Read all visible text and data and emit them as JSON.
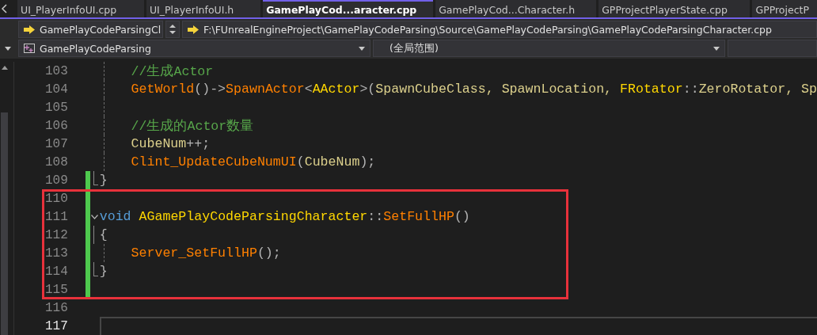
{
  "tabs": [
    {
      "label": "UI_PlayerInfoUI.cpp",
      "selected": false
    },
    {
      "label": "UI_PlayerInfoUI.h",
      "selected": false
    },
    {
      "label": "GamePlayCod...aracter.cpp",
      "selected": true
    },
    {
      "label": "GamePlayCod...Character.h",
      "selected": false
    },
    {
      "label": "GPProjectPlayerState.cpp",
      "selected": false
    },
    {
      "label": "GPProjectP",
      "selected": false
    }
  ],
  "navigation": {
    "member_dropdown": "GamePlayCodeParsingCl",
    "file_path": "F:\\FUnrealEngineProject\\GamePlayCodeParsing\\Source\\GamePlayCodeParsing\\GamePlayCodeParsingCharacter.cpp",
    "project_dropdown": "GamePlayCodeParsing",
    "scope_dropdown": "(全局范围)"
  },
  "editor": {
    "blocks": [
      {
        "highlighted": false,
        "lines": [
          {
            "number": "103",
            "indent_guide": {
              "kind": "dashed"
            },
            "changed": false,
            "foldable": false,
            "current": false,
            "tokens": [
              {
                "kind": "comment",
                "text": "    //生成Actor"
              }
            ]
          },
          {
            "number": "104",
            "indent_guide": {
              "kind": "dashed"
            },
            "changed": false,
            "foldable": false,
            "current": false,
            "tokens": [
              {
                "kind": "function",
                "text": "    GetWorld"
              },
              {
                "kind": "punct",
                "text": "()->"
              },
              {
                "kind": "function",
                "text": "SpawnActor"
              },
              {
                "kind": "punct",
                "text": "<"
              },
              {
                "kind": "type",
                "text": "AActor"
              },
              {
                "kind": "punct",
                "text": ">("
              },
              {
                "kind": "variable",
                "text": "SpawnCubeClass, SpawnLocation, "
              },
              {
                "kind": "type",
                "text": "FRotator"
              },
              {
                "kind": "punct",
                "text": "::"
              },
              {
                "kind": "variable",
                "text": "ZeroRotator, Sp"
              }
            ]
          },
          {
            "number": "105",
            "indent_guide": {
              "kind": "dashed"
            },
            "changed": false,
            "foldable": false,
            "current": false
          },
          {
            "number": "106",
            "indent_guide": {
              "kind": "dashed"
            },
            "changed": false,
            "foldable": false,
            "current": false,
            "tokens": [
              {
                "kind": "comment",
                "text": "    //生成的Actor数量"
              }
            ]
          },
          {
            "number": "107",
            "indent_guide": {
              "kind": "dashed"
            },
            "changed": false,
            "foldable": false,
            "current": false,
            "tokens": [
              {
                "kind": "variable",
                "text": "    CubeNum"
              },
              {
                "kind": "punct",
                "text": "++;"
              }
            ]
          },
          {
            "number": "108",
            "indent_guide": {
              "kind": "dashed"
            },
            "changed": false,
            "foldable": false,
            "current": false,
            "tokens": [
              {
                "kind": "function",
                "text": "    Clint_UpdateCubeNumUI"
              },
              {
                "kind": "punct",
                "text": "("
              },
              {
                "kind": "variable",
                "text": "CubeNum"
              },
              {
                "kind": "punct",
                "text": ");"
              }
            ]
          },
          {
            "number": "109",
            "indent_guide": {
              "kind": "corner"
            },
            "changed": true,
            "foldable": false,
            "current": false,
            "tokens": [
              {
                "kind": "punct",
                "text": "}"
              }
            ]
          }
        ]
      },
      {
        "highlighted": true,
        "lines": [
          {
            "number": "110",
            "changed": true,
            "foldable": false,
            "current": false
          },
          {
            "number": "111",
            "changed": true,
            "foldable": true,
            "current": false,
            "tokens": [
              {
                "kind": "keyword",
                "text": "void"
              },
              {
                "kind": "type",
                "text": " AGamePlayCodeParsingCharacter"
              },
              {
                "kind": "punct",
                "text": "::"
              },
              {
                "kind": "function",
                "text": "SetFullHP"
              },
              {
                "kind": "punct",
                "text": "()"
              }
            ]
          },
          {
            "number": "112",
            "indent_guide": {
              "kind": "solid"
            },
            "changed": true,
            "foldable": false,
            "current": false,
            "tokens": [
              {
                "kind": "punct",
                "text": "{"
              }
            ]
          },
          {
            "number": "113",
            "indent_guide": {
              "kind": "dashed"
            },
            "changed": true,
            "foldable": false,
            "current": false,
            "tokens": [
              {
                "kind": "function",
                "text": "    Server_SetFullHP"
              },
              {
                "kind": "punct",
                "text": "();"
              }
            ]
          },
          {
            "number": "114",
            "indent_guide": {
              "kind": "corner"
            },
            "changed": true,
            "foldable": false,
            "current": false,
            "tokens": [
              {
                "kind": "punct",
                "text": "}"
              }
            ]
          },
          {
            "number": "115",
            "changed": true,
            "foldable": false,
            "current": false
          }
        ]
      },
      {
        "highlighted": false,
        "lines": [
          {
            "number": "116",
            "changed": false,
            "foldable": false,
            "current": false
          },
          {
            "number": "117",
            "changed": false,
            "foldable": false,
            "current": true
          }
        ]
      }
    ]
  }
}
